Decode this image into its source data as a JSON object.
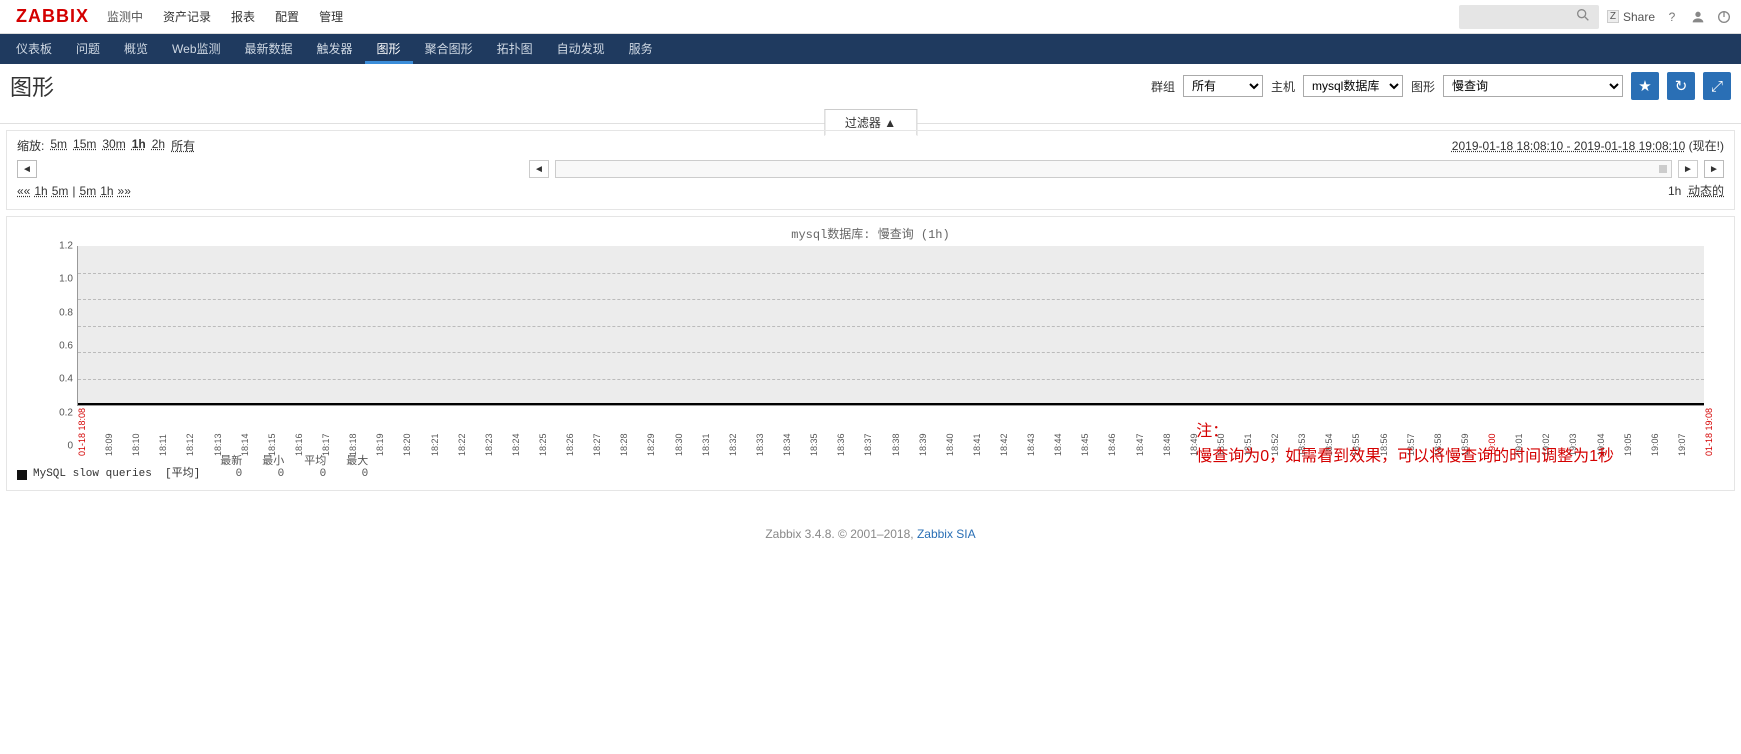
{
  "logo": "ZABBIX",
  "topmenu": [
    "监测中",
    "资产记录",
    "报表",
    "配置",
    "管理"
  ],
  "topmenu_active": 0,
  "share": "Share",
  "subnav": [
    "仪表板",
    "问题",
    "概览",
    "Web监测",
    "最新数据",
    "触发器",
    "图形",
    "聚合图形",
    "拓扑图",
    "自动发现",
    "服务"
  ],
  "subnav_active": 6,
  "page_title": "图形",
  "selectors": {
    "group_label": "群组",
    "group_value": "所有",
    "host_label": "主机",
    "host_value": "mysql数据库",
    "graph_label": "图形",
    "graph_value": "慢查询"
  },
  "filter_tab": "过滤器",
  "zoom": {
    "label": "缩放:",
    "options": [
      "5m",
      "15m",
      "30m",
      "1h",
      "2h",
      "所有"
    ],
    "bold_index": 3,
    "timerange": "2019-01-18 18:08:10 - 2019-01-18 19:08:10",
    "now": "(现在!)",
    "quick_left": [
      "««",
      "1h",
      "5m"
    ],
    "quick_right": [
      "5m",
      "1h",
      "»»"
    ],
    "status_left": "1h",
    "status_right": "动态的"
  },
  "chart_data": {
    "type": "line",
    "title": "mysql数据库: 慢查询 (1h)",
    "ylabel": "",
    "ylim": [
      0,
      1.2
    ],
    "yticks": [
      0,
      0.2,
      0.4,
      0.6,
      0.8,
      1.0,
      1.2
    ],
    "xticks": [
      "01-18 18:08",
      "18:09",
      "18:10",
      "18:11",
      "18:12",
      "18:13",
      "18:14",
      "18:15",
      "18:16",
      "18:17",
      "18:18",
      "18:19",
      "18:20",
      "18:21",
      "18:22",
      "18:23",
      "18:24",
      "18:25",
      "18:26",
      "18:27",
      "18:28",
      "18:29",
      "18:30",
      "18:31",
      "18:32",
      "18:33",
      "18:34",
      "18:35",
      "18:36",
      "18:37",
      "18:38",
      "18:39",
      "18:40",
      "18:41",
      "18:42",
      "18:43",
      "18:44",
      "18:45",
      "18:46",
      "18:47",
      "18:48",
      "18:49",
      "18:50",
      "18:51",
      "18:52",
      "18:53",
      "18:54",
      "18:55",
      "18:56",
      "18:57",
      "18:58",
      "18:59",
      "19:00",
      "19:01",
      "19:02",
      "19:03",
      "19:04",
      "19:05",
      "19:06",
      "19:07",
      "01-18 19:08"
    ],
    "xticks_red": [
      0,
      52,
      60
    ],
    "series": [
      {
        "name": "MySQL slow queries",
        "agg": "[平均]",
        "color": "#111111",
        "values_all_zero": true
      }
    ],
    "legend_headers": [
      "最新",
      "最小",
      "平均",
      "最大"
    ],
    "legend_values": [
      0,
      0,
      0,
      0
    ]
  },
  "annotation": {
    "line1": "注：",
    "line2": "慢查询为0，如需看到效果，可以将慢查询的时间调整为1秒"
  },
  "footer": {
    "text": "Zabbix 3.4.8. © 2001–2018, ",
    "link": "Zabbix SIA"
  }
}
